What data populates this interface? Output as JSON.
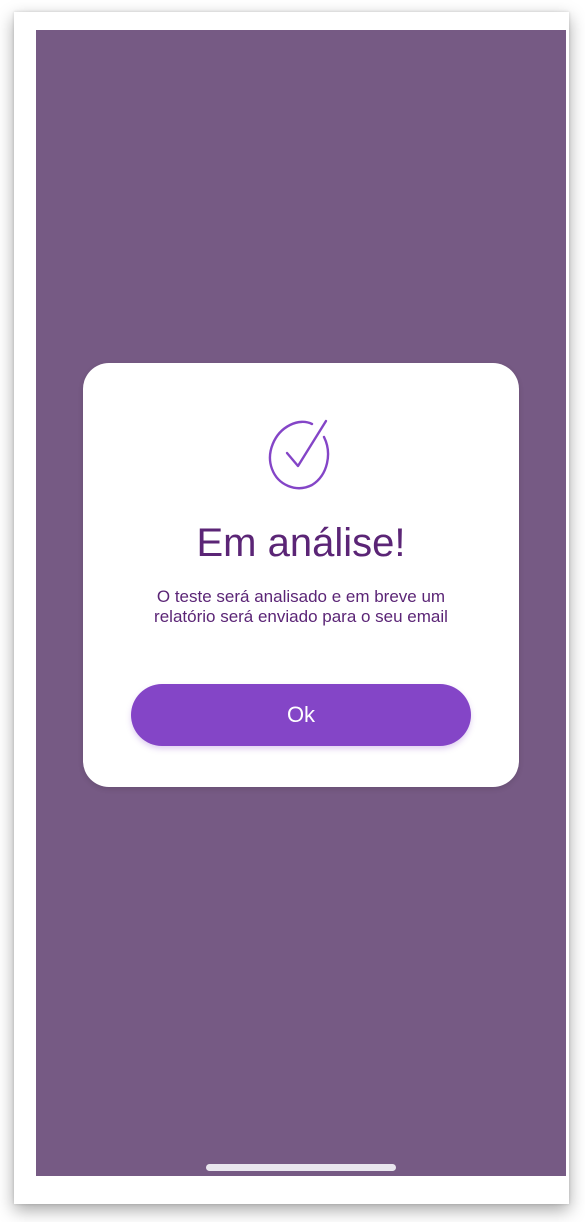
{
  "modal": {
    "icon": "check-circle-icon",
    "title": "Em análise!",
    "message": "O teste será analisado e em breve um\nrelatório será enviado  para o seu email",
    "ok_label": "Ok"
  },
  "colors": {
    "overlay": "#765a84",
    "accent": "#8445c7",
    "title_text": "#5b2576",
    "card": "#ffffff"
  }
}
